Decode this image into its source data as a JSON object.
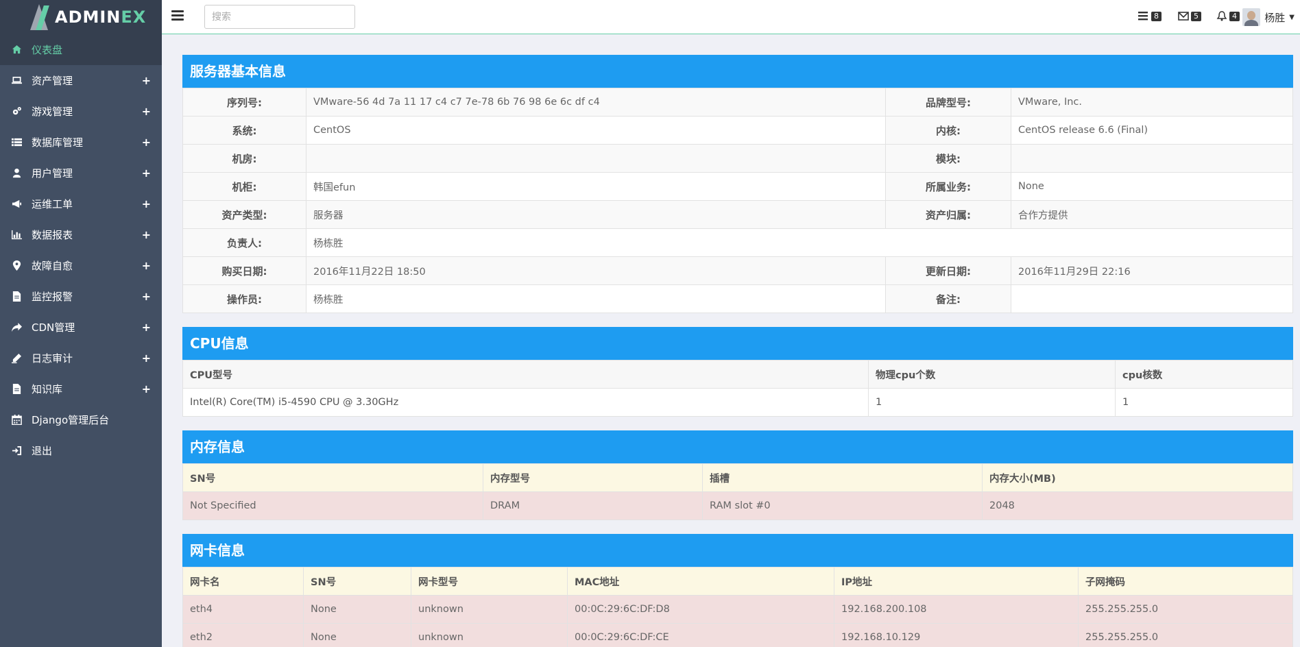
{
  "brand": {
    "part1": "ADMIN",
    "part2": "EX"
  },
  "sidebar": {
    "items": [
      {
        "label": "仪表盘",
        "icon": "home-icon",
        "active": true,
        "expandable": false
      },
      {
        "label": "资产管理",
        "icon": "laptop-icon",
        "expandable": true
      },
      {
        "label": "游戏管理",
        "icon": "cogs-icon",
        "expandable": true
      },
      {
        "label": "数据库管理",
        "icon": "list-icon",
        "expandable": true
      },
      {
        "label": "用户管理",
        "icon": "user-icon",
        "expandable": true
      },
      {
        "label": "运维工单",
        "icon": "bullhorn-icon",
        "expandable": true
      },
      {
        "label": "数据报表",
        "icon": "bar-chart-icon",
        "expandable": true
      },
      {
        "label": "故障自愈",
        "icon": "map-marker-icon",
        "expandable": true
      },
      {
        "label": "监控报警",
        "icon": "file-icon",
        "expandable": true
      },
      {
        "label": "CDN管理",
        "icon": "share-icon",
        "expandable": true
      },
      {
        "label": "日志审计",
        "icon": "pencil-icon",
        "expandable": true
      },
      {
        "label": "知识库",
        "icon": "file-icon",
        "expandable": true
      },
      {
        "label": "Django管理后台",
        "icon": "calendar-icon",
        "expandable": false
      },
      {
        "label": "退出",
        "icon": "sign-in-icon",
        "expandable": false
      }
    ],
    "plus": "+"
  },
  "header": {
    "search_placeholder": "搜索",
    "tasks_count": "8",
    "mail_count": "5",
    "notif_count": "4",
    "username": "杨胜",
    "caret": "▼"
  },
  "server": {
    "title": "服务器基本信息",
    "rows": [
      [
        {
          "l": "序列号:",
          "v": "VMware-56 4d 7a 11 17 c4 c7 7e-78 6b 76 98 6e 6c df c4"
        },
        {
          "l": "品牌型号:",
          "v": "VMware, Inc."
        }
      ],
      [
        {
          "l": "系统:",
          "v": "CentOS"
        },
        {
          "l": "内核:",
          "v": "CentOS release 6.6 (Final)"
        }
      ],
      [
        {
          "l": "机房:",
          "v": ""
        },
        {
          "l": "模块:",
          "v": ""
        }
      ],
      [
        {
          "l": "机柜:",
          "v": "韩国efun"
        },
        {
          "l": "所属业务:",
          "v": "None"
        }
      ],
      [
        {
          "l": "资产类型:",
          "v": "服务器"
        },
        {
          "l": "资产归属:",
          "v": "合作方提供"
        }
      ],
      [
        {
          "l": "负责人:",
          "v": "杨栋胜"
        }
      ],
      [
        {
          "l": "购买日期:",
          "v": "2016年11月22日 18:50"
        },
        {
          "l": "更新日期:",
          "v": "2016年11月29日 22:16"
        }
      ],
      [
        {
          "l": "操作员:",
          "v": "杨栋胜"
        },
        {
          "l": "备注:",
          "v": ""
        }
      ]
    ]
  },
  "cpu": {
    "title": "CPU信息",
    "headers": [
      "CPU型号",
      "物理cpu个数",
      "cpu核数"
    ],
    "rows": [
      [
        "Intel(R) Core(TM) i5-4590 CPU @ 3.30GHz",
        "1",
        "1"
      ]
    ]
  },
  "memory": {
    "title": "内存信息",
    "headers": [
      "SN号",
      "内存型号",
      "插槽",
      "内存大小(MB)"
    ],
    "rows": [
      [
        "Not Specified",
        "DRAM",
        "RAM slot #0",
        "2048"
      ]
    ]
  },
  "nic": {
    "title": "网卡信息",
    "headers": [
      "网卡名",
      "SN号",
      "网卡型号",
      "MAC地址",
      "IP地址",
      "子网掩码"
    ],
    "rows": [
      [
        "eth4",
        "None",
        "unknown",
        "00:0C:29:6C:DF:D8",
        "192.168.200.108",
        "255.255.255.0"
      ],
      [
        "eth2",
        "None",
        "unknown",
        "00:0C:29:6C:DF:CE",
        "192.168.10.129",
        "255.255.255.0"
      ]
    ]
  }
}
